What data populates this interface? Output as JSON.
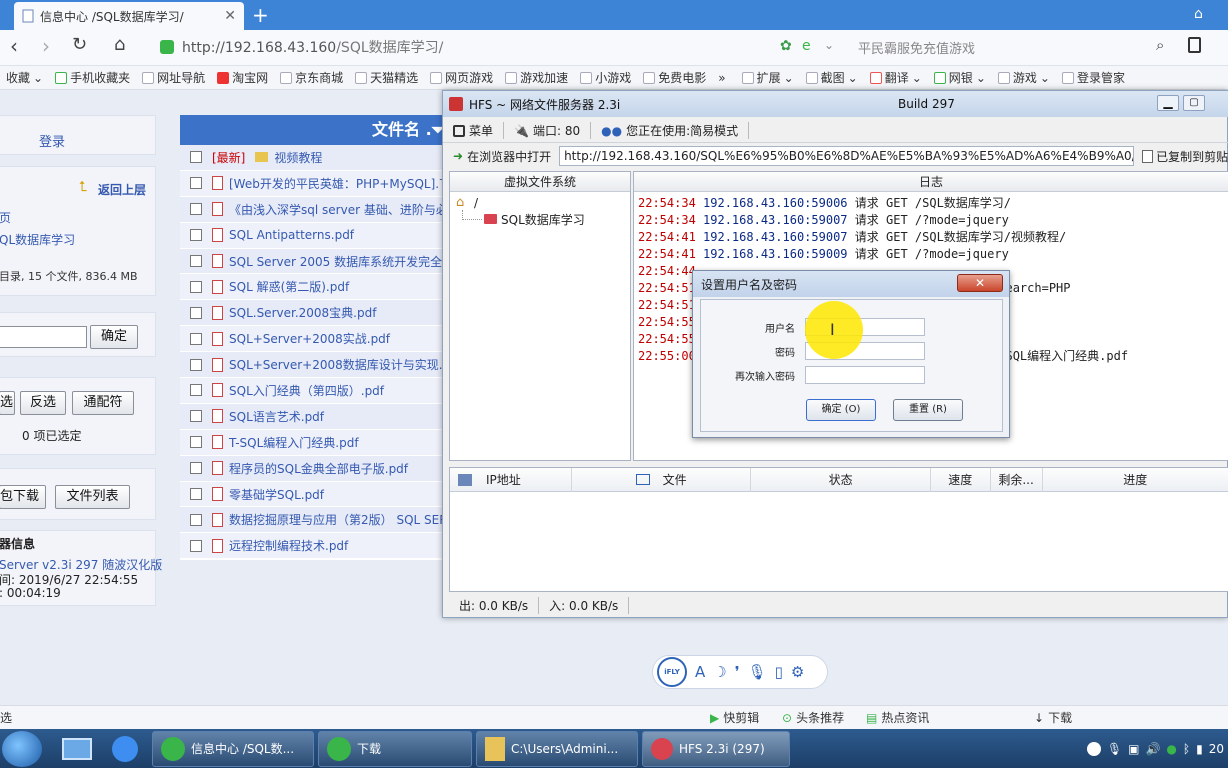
{
  "browser": {
    "tab_title": "信息中心 /SQL数据库学习/",
    "url_host": "http://192.168.43.160",
    "url_path": "/SQL数据库学习/",
    "search_placeholder": "平民霸服免充值游戏",
    "favorites": [
      "收藏",
      "手机收藏夹",
      "网址导航",
      "淘宝网",
      "京东商城",
      "天猫精选",
      "网页游戏",
      "游戏加速",
      "小游戏",
      "免费电影"
    ],
    "tools": [
      "扩展",
      "截图",
      "翻译",
      "网银",
      "游戏",
      "登录管家"
    ]
  },
  "left_panel": {
    "login": "登录",
    "back_up": "返回上层",
    "nav_home": "页",
    "nav_folder": "QL数据库学习",
    "summary": "目录, 15 个文件, 836.4 MB",
    "confirm": "确定",
    "select_all": "选",
    "invert": "反选",
    "wildcard": "通配符",
    "selected_count": "0 项已选定",
    "pack_download": "包下载",
    "file_list": "文件列表",
    "server_info_title": "器信息",
    "server_version": "Server v2.3i 297 随波汉化版",
    "server_time": "间: 2019/6/27 22:54:55",
    "uptime": ": 00:04:19"
  },
  "file_list": {
    "header": "文件名 .⏷",
    "newest_tag": "[最新]",
    "files": [
      "视频教程",
      "[Web开发的平民英雄：PHP+MySQL].丁",
      "《由浅入深学sql server 基础、进阶与必",
      "SQL Antipatterns.pdf",
      "SQL Server 2005 数据库系统开发完全手",
      "SQL 解惑(第二版).pdf",
      "SQL.Server.2008宝典.pdf",
      "SQL+Server+2008实战.pdf",
      "SQL+Server+2008数据库设计与实现.pd",
      "SQL入门经典（第四版）.pdf",
      "SQL语言艺术.pdf",
      "T-SQL编程入门经典.pdf",
      "程序员的SQL金典全部电子版.pdf",
      "零基础学SQL.pdf",
      "数据挖掘原理与应用（第2版） SQL SER",
      "远程控制编程技术.pdf"
    ]
  },
  "hfs": {
    "title": "HFS ~ 网络文件服务器 2.3i",
    "build": "Build 297",
    "menu": "菜单",
    "port": "端口: 80",
    "mode": "您正在使用:简易模式",
    "open_in_browser": "在浏览器中打开",
    "url": "http://192.168.43.160/SQL%E6%95%B0%E6%8D%AE%E5%BA%93%E5%AD%A6%E4%B9%A0/",
    "copied": "已复制到剪贴",
    "vfs_header": "虚拟文件系统",
    "vfs_root": "/",
    "vfs_folder": "SQL数据库学习",
    "log_header": "日志",
    "log": [
      {
        "t": "22:54:34",
        "ip": "192.168.43.160:59006",
        "msg": "请求 GET /SQL数据库学习/"
      },
      {
        "t": "22:54:34",
        "ip": "192.168.43.160:59007",
        "msg": "请求 GET /?mode=jquery"
      },
      {
        "t": "22:54:41",
        "ip": "192.168.43.160:59007",
        "msg": "请求 GET /SQL数据库学习/视频教程/"
      },
      {
        "t": "22:54:41",
        "ip": "192.168.43.160:59009",
        "msg": "请求 GET /?mode=jquery"
      },
      {
        "t": "22:54:44",
        "ip": "",
        "msg": ""
      },
      {
        "t": "22:54:51",
        "ip": "",
        "msg": "?search=PHP"
      },
      {
        "t": "22:54:51",
        "ip": "",
        "msg": ""
      },
      {
        "t": "22:54:55",
        "ip": "",
        "msg": ""
      },
      {
        "t": "22:54:55",
        "ip": "",
        "msg": ""
      },
      {
        "t": "22:55:00",
        "ip": "",
        "msg": "T-SQL编程入门经典.pdf"
      }
    ],
    "columns": [
      "IP地址",
      "文件",
      "状态",
      "速度",
      "剩余...",
      "进度"
    ],
    "out": "出: 0.0 KB/s",
    "in": "入: 0.0 KB/s"
  },
  "dialog": {
    "title": "设置用户名及密码",
    "username": "用户名",
    "password": "密码",
    "password_again": "再次输入密码",
    "ok": "确定 (O)",
    "reset": "重置 (R)"
  },
  "status_bar": {
    "left": "选",
    "items": [
      "快剪辑",
      "头条推荐",
      "热点资讯",
      "下载"
    ]
  },
  "taskbar": {
    "items": [
      "信息中心 /SQL数...",
      "下载",
      "C:\\Users\\Admini...",
      "HFS 2.3i (297)"
    ],
    "clock": "20"
  },
  "colors": {
    "accent": "#3c72c8",
    "tab_strip": "#3e84d6",
    "log_time": "#c00000"
  }
}
